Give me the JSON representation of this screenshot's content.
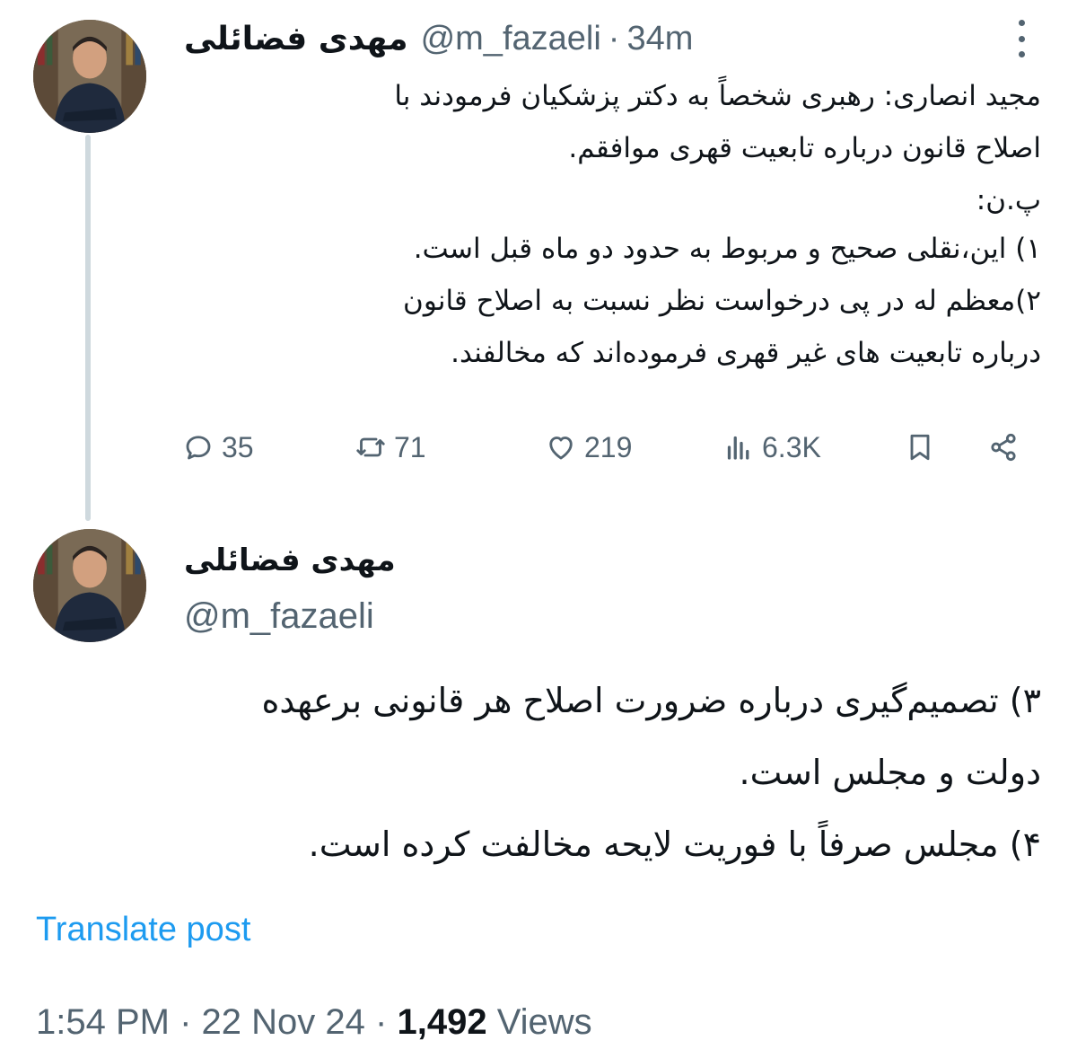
{
  "tweet1": {
    "author_name": "مهدی فضائلی",
    "handle": "@m_fazaeli",
    "separator": "·",
    "time_ago": "34m",
    "lines": [
      "مجید انصاری: رهبری شخصاً به دکتر پزشکیان فرمودند با",
      "اصلاح قانون درباره تابعیت قهری موافقم.",
      "پ.ن:",
      "۱) این،نقلی صحیح و مربوط به حدود دو ماه قبل است.",
      "۲)معظم له در پی درخواست نظر نسبت به اصلاح قانون",
      "درباره تابعیت های غیر قهری فرموده‌اند که مخالفند."
    ],
    "actions": {
      "replies": "35",
      "reposts": "71",
      "likes": "219",
      "views": "6.3K"
    },
    "icons": [
      "more-icon",
      "reply-icon",
      "repost-icon",
      "like-icon",
      "views-icon",
      "bookmark-icon",
      "share-icon"
    ]
  },
  "tweet2": {
    "author_name": "مهدی فضائلی",
    "handle": "@m_fazaeli",
    "lines": [
      "۳) تصمیم‌گیری درباره ضرورت اصلاح هر قانونی برعهده",
      "دولت و مجلس است.",
      "۴) مجلس صرفاً با فوریت لایحه مخالفت کرده است."
    ],
    "translate_label": "Translate post",
    "time": "1:54 PM",
    "date": "22 Nov 24",
    "separator": "·",
    "views_count": "1,492",
    "views_label": "Views"
  },
  "colors": {
    "text": "#0f1419",
    "secondary": "#536471",
    "link": "#1d9bf0",
    "thread_line": "#cfd9de"
  }
}
